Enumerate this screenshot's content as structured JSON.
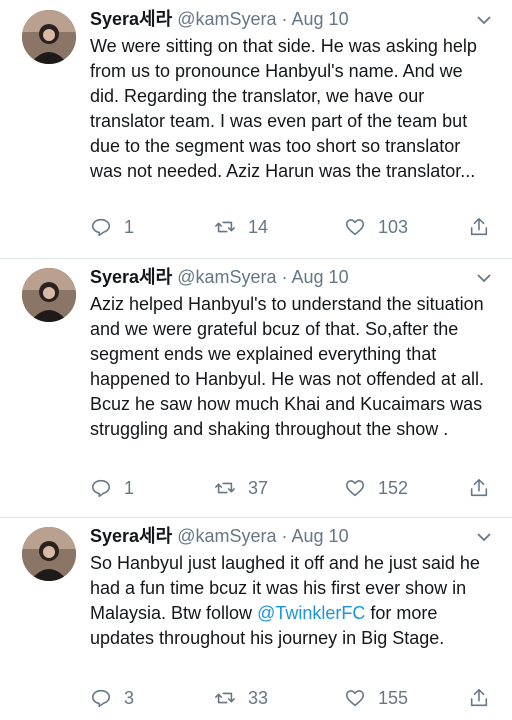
{
  "tweets": [
    {
      "display_name": "Syera세라",
      "handle": "@kamSyera",
      "separator": "·",
      "date": "Aug 10",
      "text": "We were sitting on that side. He was asking help from us to pronounce Hanbyul's name. And we did. Regarding the translator, we have our translator team. I was even part of the team but due to the segment was too short so translator was not needed. Aziz Harun was the translator...",
      "replies": "1",
      "retweets": "14",
      "likes": "103"
    },
    {
      "display_name": "Syera세라",
      "handle": "@kamSyera",
      "separator": "·",
      "date": "Aug 10",
      "text": "Aziz helped Hanbyul's to understand the situation and we were grateful bcuz of that. So,after the segment ends we explained everything that happened to Hanbyul. He was not offended at all. Bcuz he saw how much Khai and Kucaimars was struggling and shaking throughout the show .",
      "replies": "1",
      "retweets": "37",
      "likes": "152"
    },
    {
      "display_name": "Syera세라",
      "handle": "@kamSyera",
      "separator": "·",
      "date": "Aug 10",
      "text_before_link": "So Hanbyul just laughed it off and he just said he had a fun time bcuz it was his first ever show in Malaysia. Btw follow ",
      "link": "@TwinklerFC",
      "text_after_link": " for more updates throughout his journey in Big Stage.",
      "replies": "3",
      "retweets": "33",
      "likes": "155"
    }
  ],
  "icons": {
    "reply": "reply-icon",
    "retweet": "retweet-icon",
    "like": "heart-icon",
    "share": "share-icon",
    "menu": "chevron-down-icon"
  },
  "colors": {
    "text": "#14171a",
    "secondary": "#657786",
    "link": "#1b95e0",
    "divider": "#e1e8ed"
  }
}
